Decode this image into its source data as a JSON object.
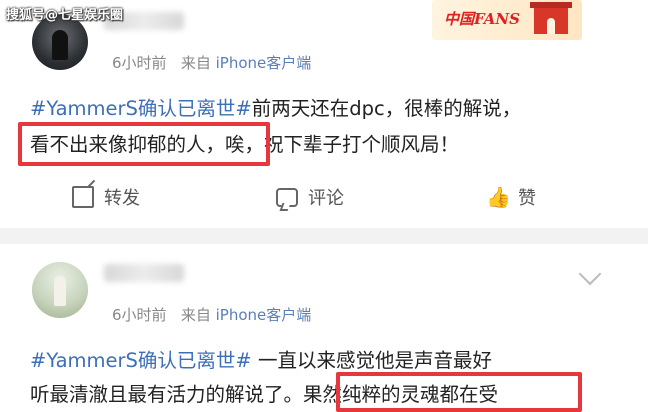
{
  "watermark": "搜狐号@七星娱乐圈",
  "badge": {
    "text": "中国FANS"
  },
  "posts": [
    {
      "time": "6小时前",
      "source_prefix": "来自 ",
      "source_device": "iPhone客户端",
      "line1_tag": "#YammerS确认已离世#",
      "line1_rest": "前两天还在dpc，很棒的解说，",
      "line2": "看不出来像抑郁的人，唉，祝下辈子打个顺风局！",
      "actions": {
        "repost": "转发",
        "comment": "评论",
        "like": "赞"
      }
    },
    {
      "time": "6小时前",
      "source_prefix": "来自 ",
      "source_device": "iPhone客户端",
      "line1_tag": "#YammerS确认已离世#",
      "line1_rest": " 一直以来感觉他是声音最好",
      "line2": "听最清澈且最有活力的解说了。果然纯粹的灵魂都在受"
    }
  ],
  "colors": {
    "highlight": "#e6373c",
    "tag": "#3d6fb8",
    "separator": "#f2f2f2"
  },
  "icons": [
    "repost-icon",
    "comment-icon",
    "like-icon",
    "chevron-down-icon"
  ]
}
